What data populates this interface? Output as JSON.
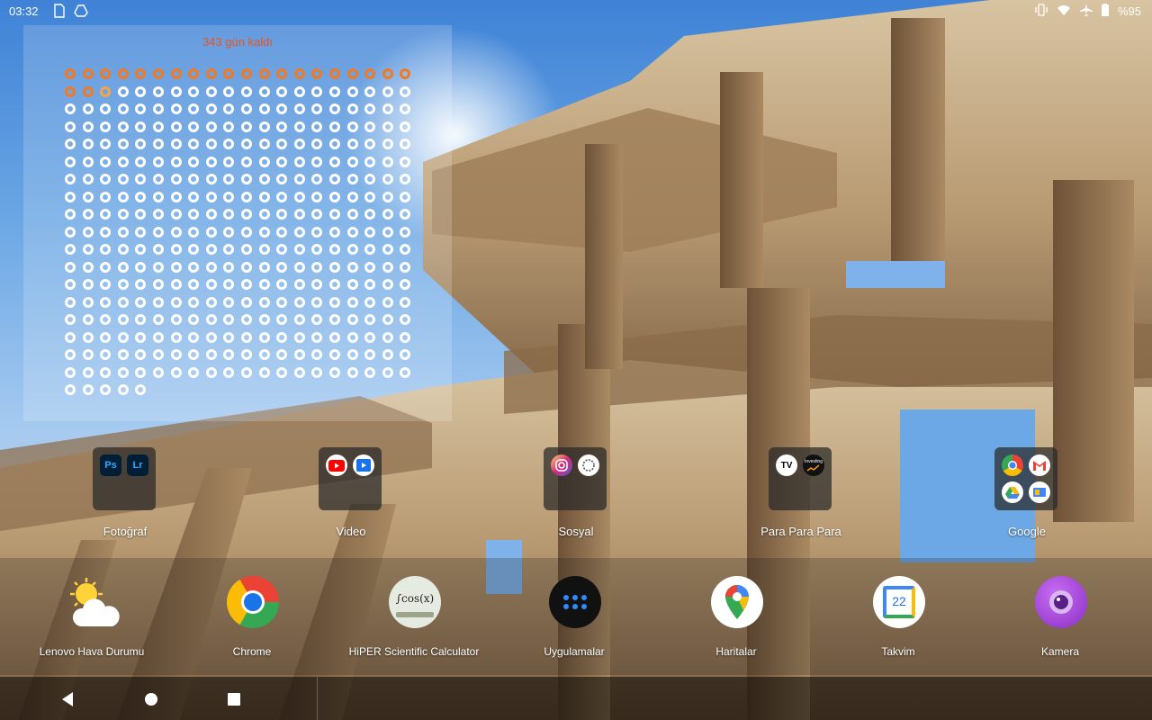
{
  "status_bar": {
    "time": "03:32",
    "battery": "%95",
    "left_icons": [
      "sim-card-icon",
      "drive-icon"
    ],
    "right_icons": [
      "vibrate-icon",
      "wifi-icon",
      "airplane-mode-icon",
      "battery-icon"
    ]
  },
  "countdown_widget": {
    "title": "343 gün kaldı",
    "total_days": 365,
    "days_remaining": 343,
    "columns": 20,
    "colors": {
      "past": "#f07a23",
      "today": "#f4a54a",
      "future": "#ffffff",
      "title": "#e8551e"
    }
  },
  "folders": [
    {
      "label": "Fotoğraf",
      "apps": [
        "photoshop-express-icon",
        "lightroom-icon"
      ]
    },
    {
      "label": "Video",
      "apps": [
        "youtube-icon",
        "video-player-icon"
      ]
    },
    {
      "label": "Sosyal",
      "apps": [
        "instagram-icon",
        "threads-icon"
      ]
    },
    {
      "label": "Para Para Para",
      "apps": [
        "tradingview-icon",
        "investing-icon"
      ]
    },
    {
      "label": "Google",
      "apps": [
        "chrome-icon",
        "gmail-icon",
        "drive-icon",
        "google-app-icon"
      ]
    }
  ],
  "dock": [
    {
      "label": "Lenovo Hava Durumu",
      "icon": "weather-icon"
    },
    {
      "label": "Chrome",
      "icon": "chrome-icon"
    },
    {
      "label": "HiPER Scientific Calculator",
      "icon": "calculator-icon",
      "icon_text": "∫cos(x)"
    },
    {
      "label": "Uygulamalar",
      "icon": "app-drawer-icon"
    },
    {
      "label": "Haritalar",
      "icon": "maps-icon"
    },
    {
      "label": "Takvim",
      "icon": "calendar-icon",
      "icon_text": "22"
    },
    {
      "label": "Kamera",
      "icon": "camera-icon"
    }
  ],
  "folder_icon_text": {
    "photoshop": "Ps",
    "lightroom": "Lr",
    "tradingview": "TV",
    "investing": "Investing"
  },
  "nav": {
    "back": "back-icon",
    "home": "home-icon",
    "recents": "recents-icon"
  }
}
